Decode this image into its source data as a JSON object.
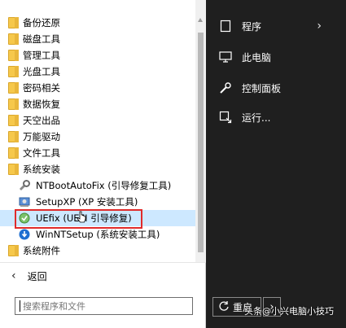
{
  "folders_top": [
    {
      "label": "备份还原"
    },
    {
      "label": "磁盘工具"
    },
    {
      "label": "管理工具"
    },
    {
      "label": "光盘工具"
    },
    {
      "label": "密码相关"
    },
    {
      "label": "数据恢复"
    },
    {
      "label": "天空出品"
    },
    {
      "label": "万能驱动"
    },
    {
      "label": "文件工具"
    },
    {
      "label": "系统安装"
    }
  ],
  "apps": [
    {
      "label": "NTBootAutoFix (引导修复工具)",
      "icon": "ntbootautofix-icon"
    },
    {
      "label": "SetupXP (XP 安装工具)",
      "icon": "setupxp-icon"
    },
    {
      "label": "UEfix (UEFI 引导修复)",
      "icon": "uefix-icon",
      "selected": true
    },
    {
      "label": "WinNTSetup (系统安装工具)",
      "icon": "winntsetup-icon"
    }
  ],
  "folders_bottom": [
    {
      "label": "系统附件"
    }
  ],
  "back_label": "返回",
  "search": {
    "placeholder": "搜索程序和文件"
  },
  "right_menu": {
    "programs": "程序",
    "this_pc": "此电脑",
    "control_panel": "控制面板",
    "run": "运行..."
  },
  "restart_label": "重启",
  "watermark": "头条@小兴电脑小技巧",
  "colors": {
    "highlight_box": "#e02b2b",
    "selected_row": "#cde8ff",
    "folder": "#f6c84b",
    "dark_bg": "#1f1f1f"
  }
}
